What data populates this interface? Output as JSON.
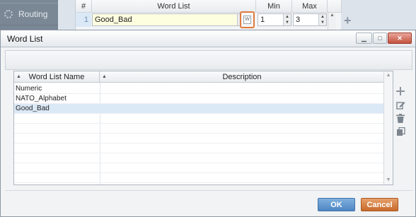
{
  "background": {
    "sidebar": {
      "item_label": "Routing"
    },
    "grid": {
      "headers": {
        "num": "#",
        "word_list": "Word List",
        "min": "Min",
        "max": "Max"
      },
      "row": {
        "num": "1",
        "word_list": "Good_Bad",
        "min": "1",
        "max": "3"
      },
      "w_button_label": "W"
    }
  },
  "dialog": {
    "title": "Word List",
    "table": {
      "columns": [
        "Word List Name",
        "Description"
      ],
      "rows": [
        {
          "name": "Numeric",
          "description": ""
        },
        {
          "name": "NATO_Alphabet",
          "description": ""
        },
        {
          "name": "Good_Bad",
          "description": "",
          "selected": true
        }
      ]
    },
    "tools": [
      "add-icon",
      "edit-icon",
      "delete-icon",
      "copy-icon"
    ],
    "buttons": {
      "ok": "OK",
      "cancel": "Cancel"
    }
  },
  "colors": {
    "ok": "#4e86c3",
    "cancel": "#c86a2a",
    "highlight": "#e07a3c",
    "selected_row": "#dbe8f6"
  }
}
